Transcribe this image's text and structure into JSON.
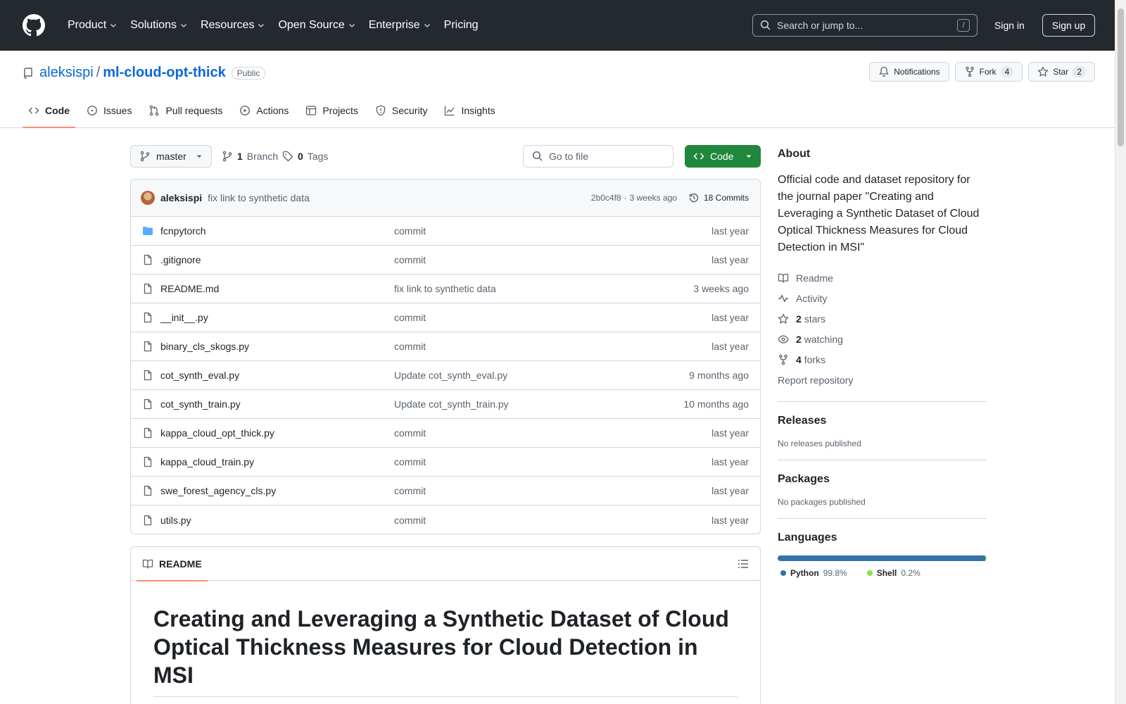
{
  "header": {
    "nav": [
      "Product",
      "Solutions",
      "Resources",
      "Open Source",
      "Enterprise",
      "Pricing"
    ],
    "search_placeholder": "Search or jump to...",
    "search_key": "/",
    "sign_in": "Sign in",
    "sign_up": "Sign up"
  },
  "repo": {
    "owner": "aleksispi",
    "separator": "/",
    "name": "ml-cloud-opt-thick",
    "visibility": "Public",
    "notifications": "Notifications",
    "fork_label": "Fork",
    "fork_count": "4",
    "star_label": "Star",
    "star_count": "2"
  },
  "tabs": [
    "Code",
    "Issues",
    "Pull requests",
    "Actions",
    "Projects",
    "Security",
    "Insights"
  ],
  "toolbar": {
    "branch": "master",
    "branch_count": "1",
    "branch_label": "Branch",
    "tag_count": "0",
    "tag_label": "Tags",
    "go_to_file": "Go to file",
    "code_button": "Code"
  },
  "latest_commit": {
    "author": "aleksispi",
    "message": "fix link to synthetic data",
    "hash": "2b0c4f8",
    "dot": "·",
    "age": "3 weeks ago",
    "commits": "18 Commits"
  },
  "files": [
    {
      "name": "fcnpytorch",
      "type": "folder",
      "message": "commit",
      "date": "last year"
    },
    {
      "name": ".gitignore",
      "type": "file",
      "message": "commit",
      "date": "last year"
    },
    {
      "name": "README.md",
      "type": "file",
      "message": "fix link to synthetic data",
      "date": "3 weeks ago"
    },
    {
      "name": "__init__.py",
      "type": "file",
      "message": "commit",
      "date": "last year"
    },
    {
      "name": "binary_cls_skogs.py",
      "type": "file",
      "message": "commit",
      "date": "last year"
    },
    {
      "name": "cot_synth_eval.py",
      "type": "file",
      "message": "Update cot_synth_eval.py",
      "date": "9 months ago"
    },
    {
      "name": "cot_synth_train.py",
      "type": "file",
      "message": "Update cot_synth_train.py",
      "date": "10 months ago"
    },
    {
      "name": "kappa_cloud_opt_thick.py",
      "type": "file",
      "message": "commit",
      "date": "last year"
    },
    {
      "name": "kappa_cloud_train.py",
      "type": "file",
      "message": "commit",
      "date": "last year"
    },
    {
      "name": "swe_forest_agency_cls.py",
      "type": "file",
      "message": "commit",
      "date": "last year"
    },
    {
      "name": "utils.py",
      "type": "file",
      "message": "commit",
      "date": "last year"
    }
  ],
  "readme": {
    "tab": "README",
    "title": "Creating and Leveraging a Synthetic Dataset of Cloud Optical Thickness Measures for Cloud Detection in MSI"
  },
  "about": {
    "heading": "About",
    "description": "Official code and dataset repository for the journal paper \"Creating and Leveraging a Synthetic Dataset of Cloud Optical Thickness Measures for Cloud Detection in MSI\"",
    "readme": "Readme",
    "activity": "Activity",
    "stars_count": "2",
    "stars_label": "stars",
    "watching_count": "2",
    "watching_label": "watching",
    "forks_count": "4",
    "forks_label": "forks",
    "report": "Report repository"
  },
  "releases": {
    "heading": "Releases",
    "text": "No releases published"
  },
  "packages": {
    "heading": "Packages",
    "text": "No packages published"
  },
  "languages": {
    "heading": "Languages",
    "items": [
      {
        "name": "Python",
        "percent": "99.8%",
        "value": 99.8,
        "color": "#3572A5"
      },
      {
        "name": "Shell",
        "percent": "0.2%",
        "value": 0.2,
        "color": "#89e051"
      }
    ]
  }
}
